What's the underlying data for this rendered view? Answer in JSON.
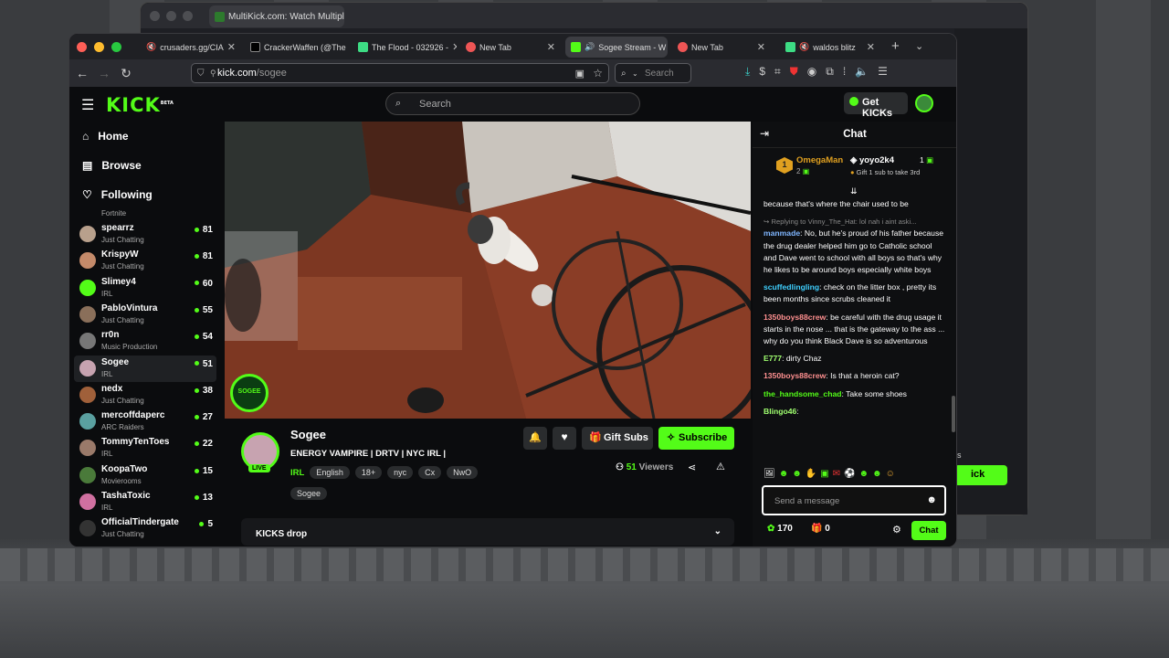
{
  "back_window": {
    "tab_title": "MultiKick.com: Watch Multiple S",
    "chat_button": "Chat",
    "side_fragment": "ages",
    "side_button_fragment": "ick"
  },
  "tabs": [
    {
      "label": "crusaders.gg/CIA",
      "fav": "#888"
    },
    {
      "label": "CrackerWaffen (@The",
      "fav": "#000"
    },
    {
      "label": "The Flood - 032926 -",
      "fav": "#3ddc84"
    },
    {
      "label": "New Tab",
      "fav": "#e55"
    },
    {
      "label": "Sogee Stream - W",
      "fav": "#53fc18"
    },
    {
      "label": "New Tab",
      "fav": "#e55"
    },
    {
      "label": "waldos blitz",
      "fav": "#3ddc84"
    }
  ],
  "url": {
    "host": "kick.com",
    "path": "/sogee"
  },
  "browser_search_placeholder": "Search",
  "kick": {
    "logo": "KICK",
    "logo_beta": "BETA",
    "search_placeholder": "Search",
    "get_kicks": "Get KICKs",
    "nav": [
      {
        "label": "Home",
        "icon": "home-icon"
      },
      {
        "label": "Browse",
        "icon": "browse-icon"
      },
      {
        "label": "Following",
        "icon": "heart-icon"
      }
    ],
    "followed_partial_category": "Fortnite",
    "following": [
      {
        "name": "spearrz",
        "category": "Just Chatting",
        "viewers": "81",
        "color": "#b8a08c"
      },
      {
        "name": "KrispyW",
        "category": "Just Chatting",
        "viewers": "81",
        "color": "#c48a6a"
      },
      {
        "name": "Slimey4",
        "category": "IRL",
        "viewers": "60",
        "color": "#53fc18"
      },
      {
        "name": "PabloVintura",
        "category": "Just Chatting",
        "viewers": "55",
        "color": "#8a6f5a"
      },
      {
        "name": "rr0n",
        "category": "Music Production",
        "viewers": "54",
        "color": "#777"
      },
      {
        "name": "Sogee",
        "category": "IRL",
        "viewers": "51",
        "color": "#c7a3b0"
      },
      {
        "name": "nedx",
        "category": "Just Chatting",
        "viewers": "38",
        "color": "#a0603a"
      },
      {
        "name": "mercoffdaperc",
        "category": "ARC Raiders",
        "viewers": "27",
        "color": "#5aa0a0"
      },
      {
        "name": "TommyTenToes",
        "category": "IRL",
        "viewers": "22",
        "color": "#9a7a6a"
      },
      {
        "name": "KoopaTwo",
        "category": "Movierooms",
        "viewers": "15",
        "color": "#4a7a3a"
      },
      {
        "name": "TashaToxic",
        "category": "IRL",
        "viewers": "13",
        "color": "#d070a0"
      },
      {
        "name": "OfficialTindergate",
        "category": "Just Chatting",
        "viewers": "5",
        "color": "#333"
      }
    ],
    "stream": {
      "overlay_badge": "SOGEE",
      "streamer": "Sogee",
      "title": "ENERGY VAMPIRE | DRTV | NYC IRL |",
      "live": "LIVE",
      "category": "IRL",
      "tags": [
        "English",
        "18+",
        "nyc",
        "Cx",
        "NwO",
        "Sogee"
      ],
      "viewers": "51",
      "viewers_label": "Viewers",
      "gift_subs": "Gift Subs",
      "subscribe": "Subscribe",
      "kicks_drop": "KICKS drop"
    },
    "chat": {
      "title": "Chat",
      "leader1": {
        "rank": "1",
        "name": "OmegaMan",
        "count": "2"
      },
      "leader2": {
        "name": "yoyo2k4",
        "count": "1",
        "note": "Gift 1 sub to take 3rd"
      },
      "messages": [
        {
          "user": "",
          "text": "because that's where the chair used to be",
          "color": "#fff"
        },
        {
          "reply": "Replying to Vinny_The_Hat: lol nah i aint aski...",
          "user": "manmade",
          "text": "No, but he's proud of his father because the drug dealer helped him go to Catholic school and Dave went to school with all boys so that's why he likes to be around boys especially white boys",
          "color": "#7fb6ff"
        },
        {
          "user": "scuffedlingling",
          "text": "check on the litter box , pretty its been months since scrubs cleaned it",
          "color": "#3fd0ff"
        },
        {
          "user": "1350boys88crew",
          "text": "be careful with the drug usage it starts in the nose ... that is the gateway to the ass ... why do you think Black Dave is so adventurous",
          "color": "#ff9090"
        },
        {
          "user": "E777",
          "text": "dirty Chaz",
          "color": "#a0ff70"
        },
        {
          "user": "1350boys88crew",
          "text": "Is that a heroin cat?",
          "color": "#ff9090"
        },
        {
          "user": "the_handsome_chad",
          "text": "Take some shoes",
          "color": "#53fc18"
        },
        {
          "user": "Blingo46",
          "text": "",
          "color": "#a0ff70"
        }
      ],
      "input_placeholder": "Send a message",
      "points": "170",
      "zero": "0",
      "send": "Chat"
    }
  }
}
